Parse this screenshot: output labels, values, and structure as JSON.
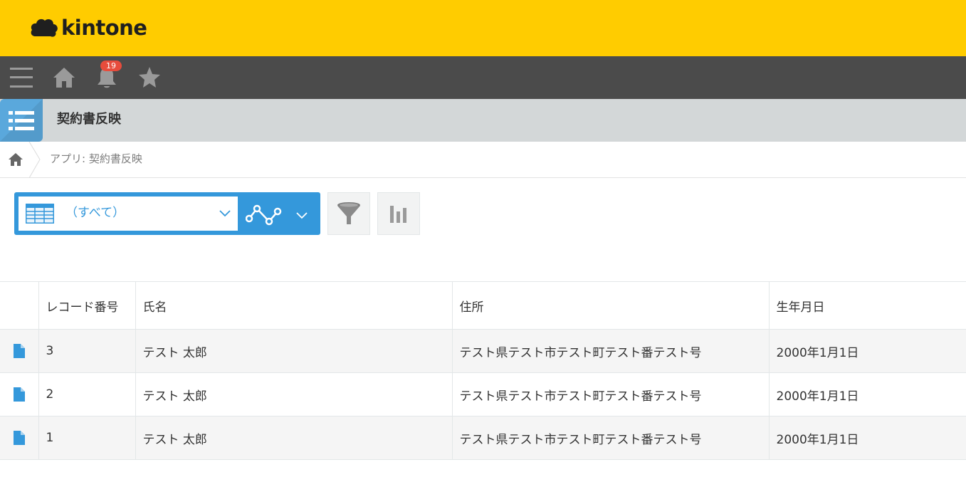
{
  "brand": {
    "name": "kintone",
    "header_color": "#ffcc00"
  },
  "navbar": {
    "items": [
      {
        "name": "menu",
        "icon": "menu-icon"
      },
      {
        "name": "home",
        "icon": "home-icon"
      },
      {
        "name": "notifications",
        "icon": "bell-icon",
        "badge": "19"
      },
      {
        "name": "favorites",
        "icon": "star-icon"
      }
    ]
  },
  "app": {
    "title": "契約書反映",
    "icon": "list-app-icon",
    "accent": "#3498db"
  },
  "breadcrumb": {
    "home_icon": "home-icon",
    "current": "アプリ: 契約書反映"
  },
  "toolbar": {
    "view_select": {
      "icon": "table-view-icon",
      "value": "（すべて）"
    },
    "graph_icon": "graph-icon",
    "filter_icon": "filter-icon",
    "chart_icon": "bar-chart-icon"
  },
  "table": {
    "columns": [
      "",
      "レコード番号",
      "氏名",
      "住所",
      "生年月日"
    ],
    "rows": [
      {
        "id": "3",
        "name": "テスト 太郎",
        "address": "テスト県テスト市テスト町テスト番テスト号",
        "birth": "2000年1月1日"
      },
      {
        "id": "2",
        "name": "テスト 太郎",
        "address": "テスト県テスト市テスト町テスト番テスト号",
        "birth": "2000年1月1日"
      },
      {
        "id": "1",
        "name": "テスト 太郎",
        "address": "テスト県テスト市テスト町テスト番テスト号",
        "birth": "2000年1月1日"
      }
    ]
  }
}
